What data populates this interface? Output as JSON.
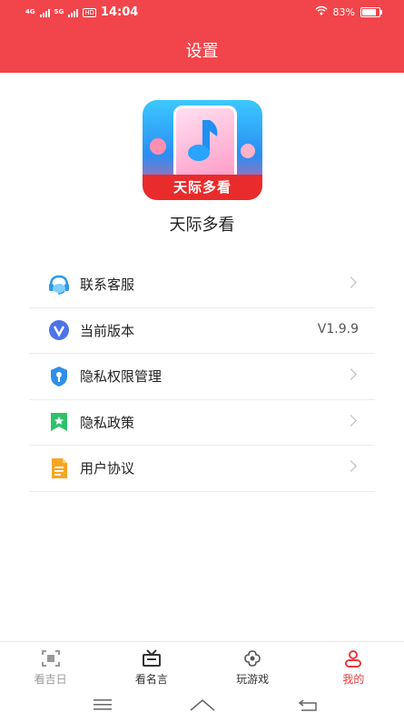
{
  "status_bar": {
    "network_1": "4G",
    "network_2": "5G",
    "hd": "HD",
    "time": "14:04",
    "battery": "83%"
  },
  "header": {
    "title": "设置"
  },
  "app": {
    "logo_text": "天际多看",
    "name": "天际多看"
  },
  "settings": {
    "items": [
      {
        "label": "联系客服",
        "icon": "headset-icon"
      },
      {
        "label": "当前版本",
        "icon": "version-icon",
        "value": "V1.9.9"
      },
      {
        "label": "隐私权限管理",
        "icon": "shield-key-icon"
      },
      {
        "label": "隐私政策",
        "icon": "bookmark-star-icon"
      },
      {
        "label": "用户协议",
        "icon": "document-icon"
      }
    ]
  },
  "bottom_nav": {
    "tabs": [
      {
        "label": "看吉日",
        "icon": "scan-frame-icon"
      },
      {
        "label": "看名言",
        "icon": "tv-box-icon"
      },
      {
        "label": "玩游戏",
        "icon": "flower-icon"
      },
      {
        "label": "我的",
        "icon": "user-icon",
        "active": true
      }
    ]
  },
  "colors": {
    "primary": "#f2454b",
    "inactive_tab": "#999999",
    "active_tab": "#e83a3f"
  }
}
